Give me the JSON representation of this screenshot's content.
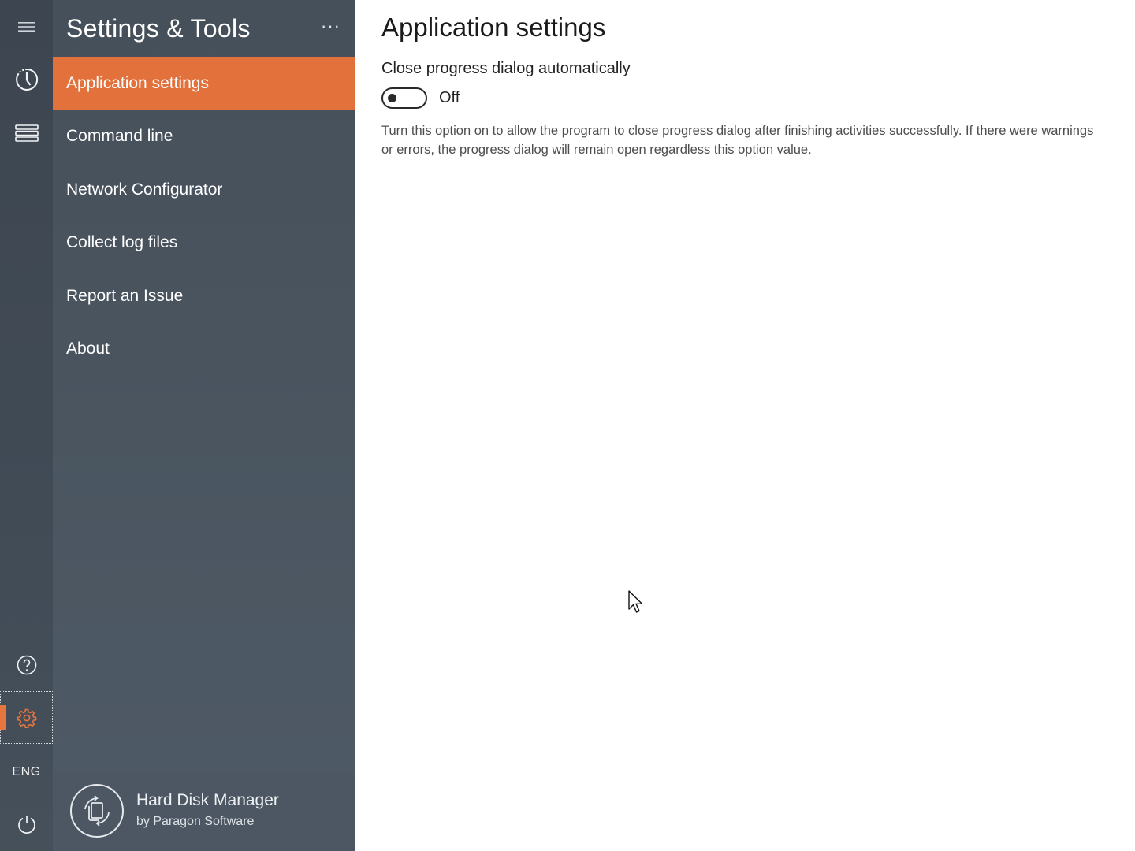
{
  "rail": {
    "language": "ENG"
  },
  "sidebar": {
    "title": "Settings & Tools",
    "more_label": "···",
    "items": [
      {
        "label": "Application settings",
        "selected": true
      },
      {
        "label": "Command line"
      },
      {
        "label": "Network Configurator"
      },
      {
        "label": "Collect log files"
      },
      {
        "label": "Report an Issue"
      },
      {
        "label": "About"
      }
    ],
    "footer": {
      "product_name": "Hard Disk Manager",
      "vendor": "by Paragon Software"
    }
  },
  "main": {
    "title": "Application settings",
    "setting": {
      "label": "Close progress dialog automatically",
      "state": "Off",
      "description": "Turn this option on to allow the program to close progress dialog after finishing activities successfully. If there were warnings or errors, the progress dialog will remain open regardless this option value."
    }
  },
  "colors": {
    "accent": "#e2713c",
    "rail_bg": "#3d4650",
    "panel_bg": "#4a5560"
  },
  "icons": {
    "menu": "hamburger-icon",
    "history": "clock-icon",
    "disks": "disk-stack-icon",
    "help": "help-icon",
    "settings": "gear-icon",
    "power": "power-icon",
    "logo": "paragon-logo-icon"
  }
}
